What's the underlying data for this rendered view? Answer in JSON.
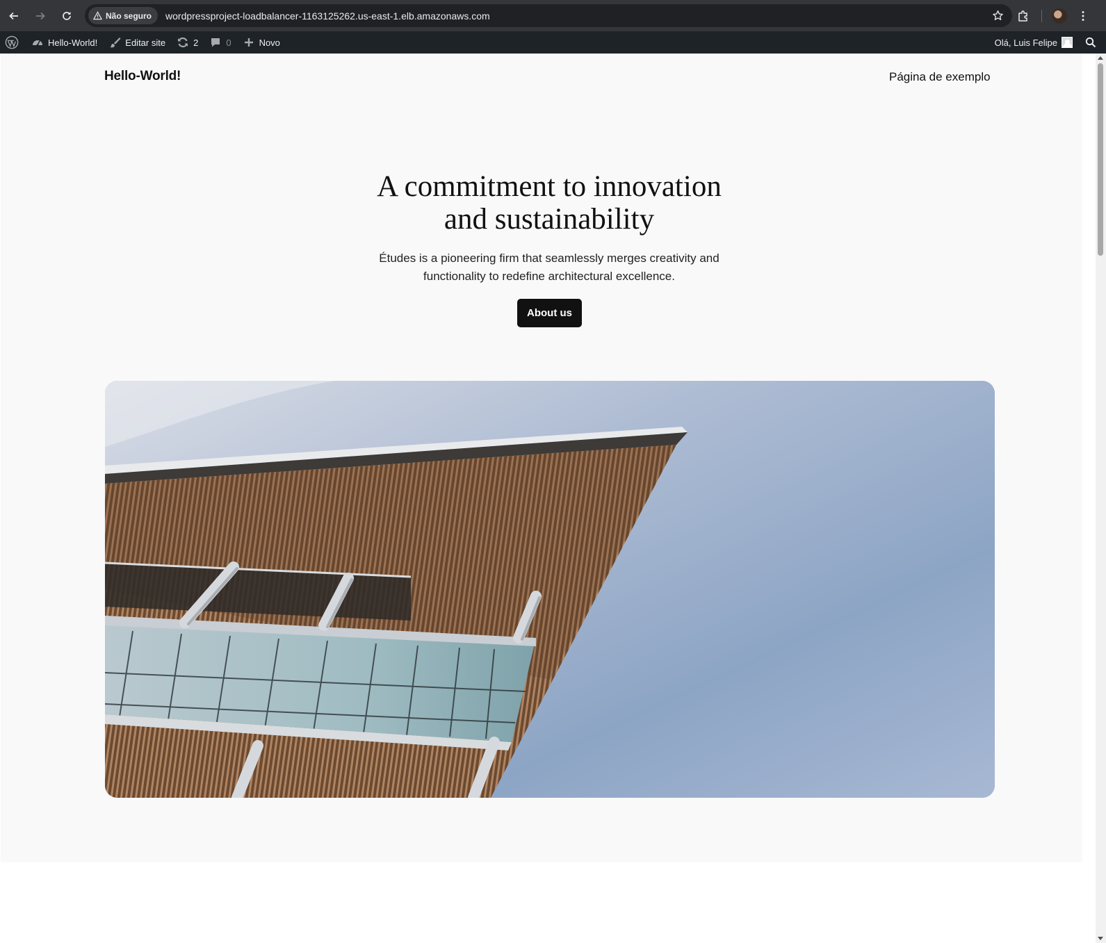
{
  "browser": {
    "security_label": "Não seguro",
    "url": "wordpressproject-loadbalancer-1163125262.us-east-1.elb.amazonaws.com",
    "icons": [
      "back-icon",
      "forward-icon",
      "reload-icon",
      "warning-icon",
      "bookmark-star-icon",
      "extensions-icon",
      "profile-avatar",
      "menu-icon"
    ]
  },
  "adminbar": {
    "site_name": "Hello-World!",
    "edit_site": "Editar site",
    "updates_count": "2",
    "comments_count": "0",
    "new_label": "Novo",
    "greeting": "Olá, Luis Felipe",
    "icons": [
      "wordpress-icon",
      "dashboard-icon",
      "brush-icon",
      "updates-icon",
      "comment-icon",
      "plus-icon",
      "search-icon"
    ]
  },
  "site": {
    "title": "Hello-World!",
    "nav_link": "Página de exemplo"
  },
  "hero": {
    "heading_line1": "A commitment to innovation",
    "heading_line2": "and sustainability",
    "text_line1": "Études is a pioneering firm that seamlessly merges creativity and",
    "text_line2": "functionality to redefine architectural excellence.",
    "button_label": "About us"
  },
  "colors": {
    "chrome_bg": "#35363a",
    "adminbar_bg": "#1d2327",
    "page_bg": "#f9f9f9",
    "button_bg": "#111111"
  }
}
